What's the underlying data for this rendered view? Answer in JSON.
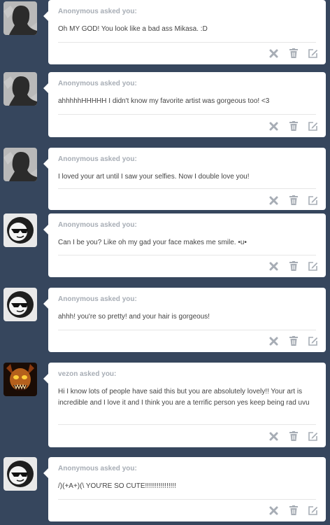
{
  "colors": {
    "background": "#36465d",
    "card": "#ffffff",
    "asker_text": "#a7adb5",
    "question_text": "#444444",
    "icon": "#a7adb5"
  },
  "asks": [
    {
      "asker": "Anonymous asked you:",
      "avatar": "anonymous-silhouette",
      "question": "Oh MY GOD! You look like a bad ass Mikasa. :D"
    },
    {
      "asker": "Anonymous asked you:",
      "avatar": "anonymous-silhouette",
      "question": "ahhhhhHHHHH I didn't know my favorite artist was gorgeous too! <3"
    },
    {
      "asker": "Anonymous asked you:",
      "avatar": "anonymous-silhouette",
      "question": "I loved your art until I saw your selfies. Now I double love you!"
    },
    {
      "asker": "Anonymous asked you:",
      "avatar": "sunglasses-face",
      "question": "Can I be you? Like oh my gad your face makes me smile. •u•"
    },
    {
      "asker": "Anonymous asked you:",
      "avatar": "sunglasses-face",
      "question": "ahhh! you're so pretty! and your hair is gorgeous!"
    },
    {
      "asker": "vezon asked you:",
      "avatar": "skull-artwork",
      "question": "Hi I know lots of people have said this but you are absolutely lovely!! Your art is incredible and I love it and I think you are a terrific person yes keep being rad uvu"
    },
    {
      "asker": "Anonymous asked you:",
      "avatar": "sunglasses-face",
      "question": "/)(+A+)(\\ YOU'RE SO CUTE!!!!!!!!!!!!!!!!"
    }
  ],
  "action_icons": [
    "delete-x-icon",
    "trash-icon",
    "edit-icon"
  ]
}
